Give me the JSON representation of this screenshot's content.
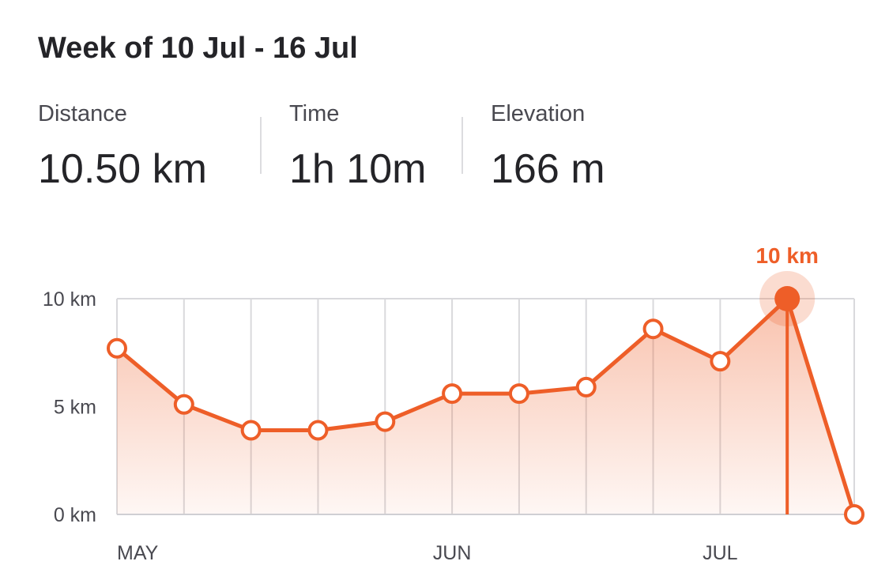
{
  "header": {
    "title": "Week of 10 Jul - 16 Jul"
  },
  "stats": [
    {
      "label": "Distance",
      "value": "10.50 km"
    },
    {
      "label": "Time",
      "value": "1h 10m"
    },
    {
      "label": "Elevation",
      "value": "166 m"
    }
  ],
  "colors": {
    "accent": "#ee5e28",
    "grid": "#d9d9dc",
    "text": "#242428",
    "muted": "#494950"
  },
  "chart_data": {
    "type": "area",
    "title": "",
    "xlabel": "",
    "ylabel": "",
    "ylim": [
      0,
      10
    ],
    "y_ticks": [
      {
        "value": 0,
        "label": "0 km"
      },
      {
        "value": 5,
        "label": "5 km"
      },
      {
        "value": 10,
        "label": "10 km"
      }
    ],
    "x_tick_labels": [
      {
        "index": 0,
        "label": "MAY"
      },
      {
        "index": 5,
        "label": "JUN"
      },
      {
        "index": 9,
        "label": "JUL"
      }
    ],
    "grid": true,
    "series": [
      {
        "unit": "km",
        "values": [
          7.7,
          5.1,
          3.9,
          3.9,
          4.3,
          5.6,
          5.6,
          5.9,
          8.6,
          7.1,
          10.0,
          0.0
        ]
      }
    ],
    "highlight": {
      "index": 10,
      "label": "10 km"
    }
  }
}
